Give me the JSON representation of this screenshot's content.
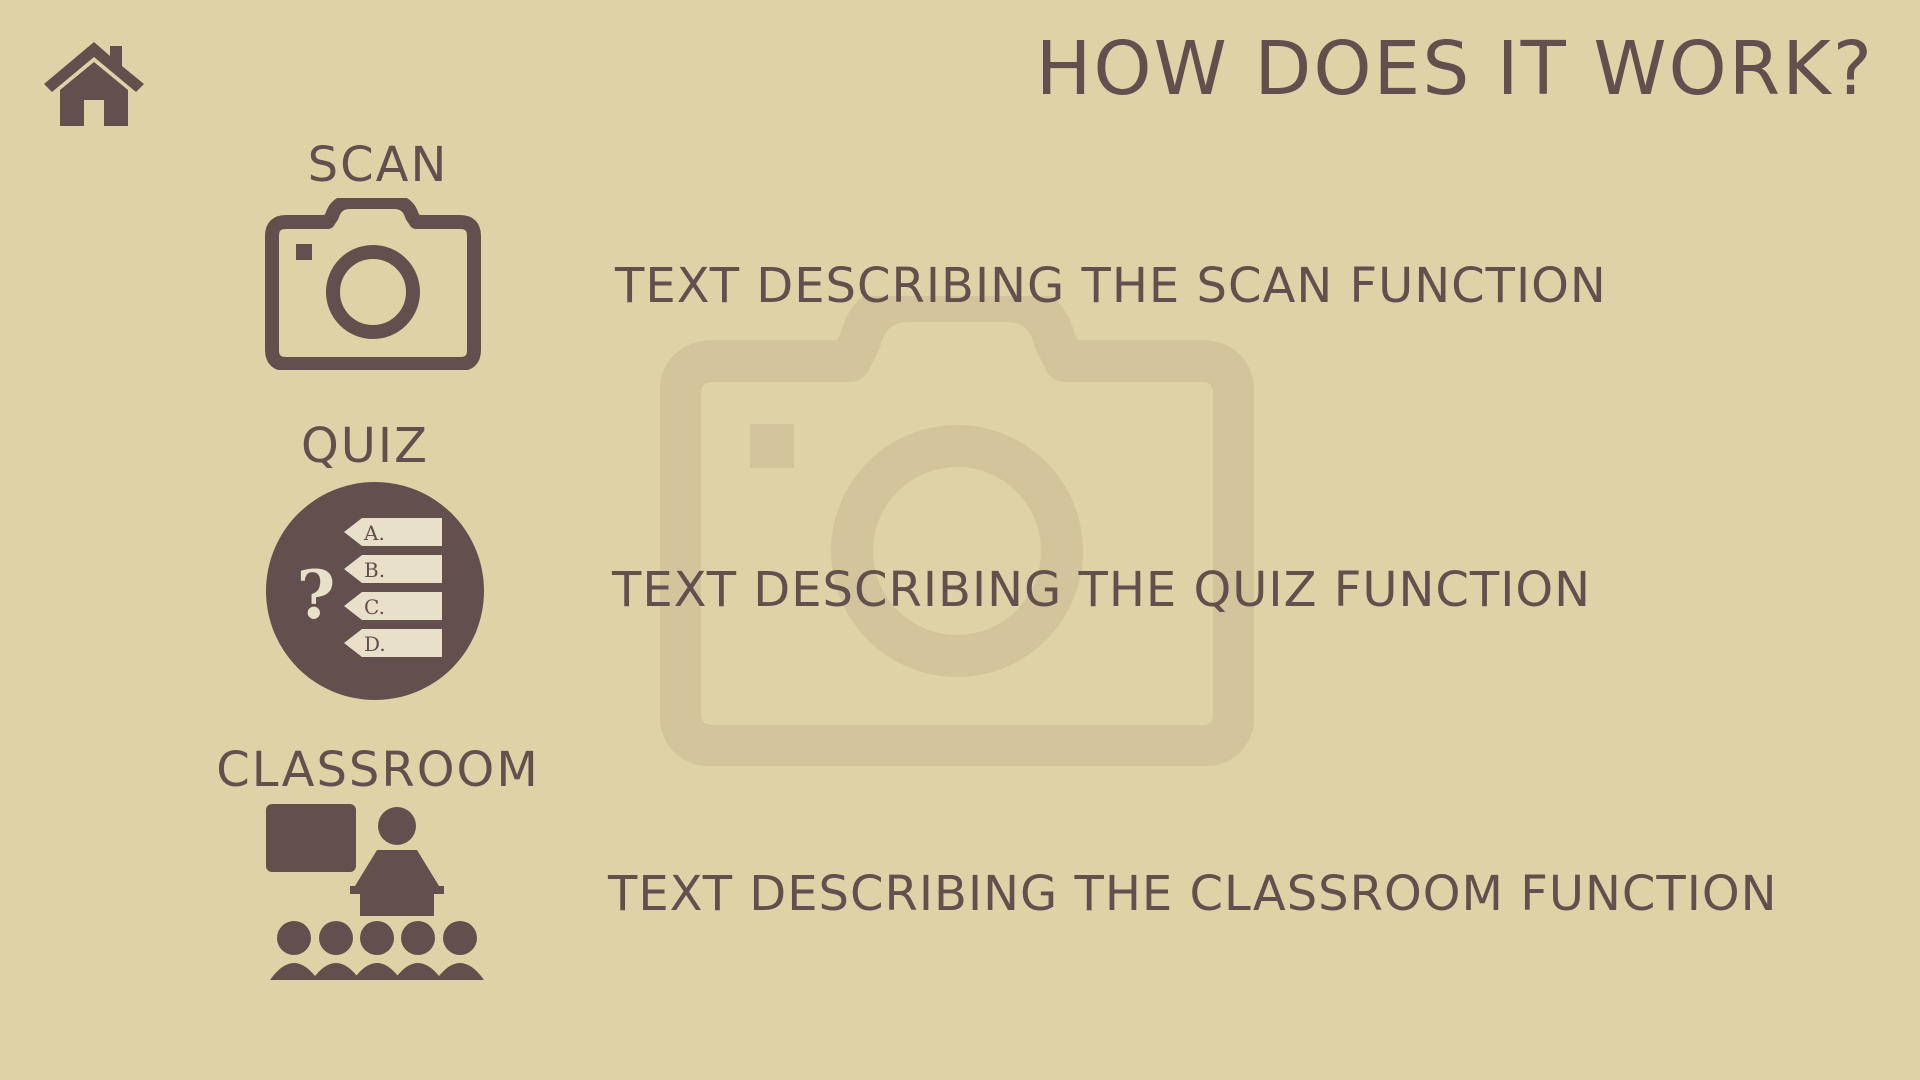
{
  "header": {
    "home_icon": "home-icon",
    "title": "HOW DOES IT WORK?"
  },
  "features": [
    {
      "label": "SCAN",
      "icon": "camera-icon",
      "description": "TEXT DESCRIBING THE SCAN FUNCTION"
    },
    {
      "label": "QUIZ",
      "icon": "quiz-icon",
      "options": [
        "A.",
        "B.",
        "C.",
        "D."
      ],
      "question_mark": "?",
      "description": "TEXT DESCRIBING THE QUIZ FUNCTION"
    },
    {
      "label": "CLASSROOM",
      "icon": "classroom-icon",
      "description": "TEXT DESCRIBING THE CLASSROOM FUNCTION"
    }
  ],
  "background": {
    "watermark_icon": "camera-watermark-icon"
  },
  "colors": {
    "background": "#e0d2a7",
    "foreground": "#634f4e",
    "watermark": "#d4c49b"
  }
}
